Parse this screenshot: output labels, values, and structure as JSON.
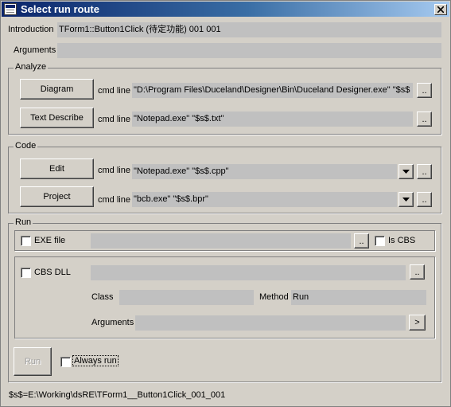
{
  "window": {
    "title": "Select run route"
  },
  "intro": {
    "label": "Introduction",
    "value": "TForm1::Button1Click (待定功能) 001 001"
  },
  "arguments": {
    "label": "Arguments",
    "value": ""
  },
  "analyze": {
    "legend": "Analyze",
    "diagram": {
      "button": "Diagram",
      "cmd_label": "cmd line",
      "value": "\"D:\\Program Files\\Duceland\\Designer\\Bin\\Duceland Designer.exe\" \"$s$",
      "browse": ".."
    },
    "text_describe": {
      "button": "Text Describe",
      "cmd_label": "cmd line",
      "value": "\"Notepad.exe\" \"$s$.txt\"",
      "browse": ".."
    }
  },
  "code": {
    "legend": "Code",
    "edit": {
      "button": "Edit",
      "cmd_label": "cmd line",
      "value": "\"Notepad.exe\" \"$s$.cpp\"",
      "browse": ".."
    },
    "project": {
      "button": "Project",
      "cmd_label": "cmd line",
      "value": "\"bcb.exe\" \"$s$.bpr\"",
      "browse": ".."
    }
  },
  "run": {
    "legend": "Run",
    "exe_file": {
      "label": "EXE file",
      "checked": false,
      "value": "",
      "browse": "..",
      "is_cbs_label": "Is CBS",
      "is_cbs_checked": false
    },
    "cbs_dll": {
      "label": "CBS DLL",
      "checked": false,
      "value": "",
      "browse": "..",
      "class_label": "Class",
      "class_value": "",
      "method_label": "Method",
      "method_value": "Run",
      "arguments_label": "Arguments",
      "arguments_value": "",
      "go": ">"
    },
    "run_button": "Run",
    "always_run_label": "Always run",
    "always_run_checked": false
  },
  "status": "$s$=E:\\Working\\dsRE\\TForm1__Button1Click_001_001",
  "icons": {
    "app": "form-icon",
    "close": "close-icon",
    "dropdown": "chevron-down-icon"
  }
}
